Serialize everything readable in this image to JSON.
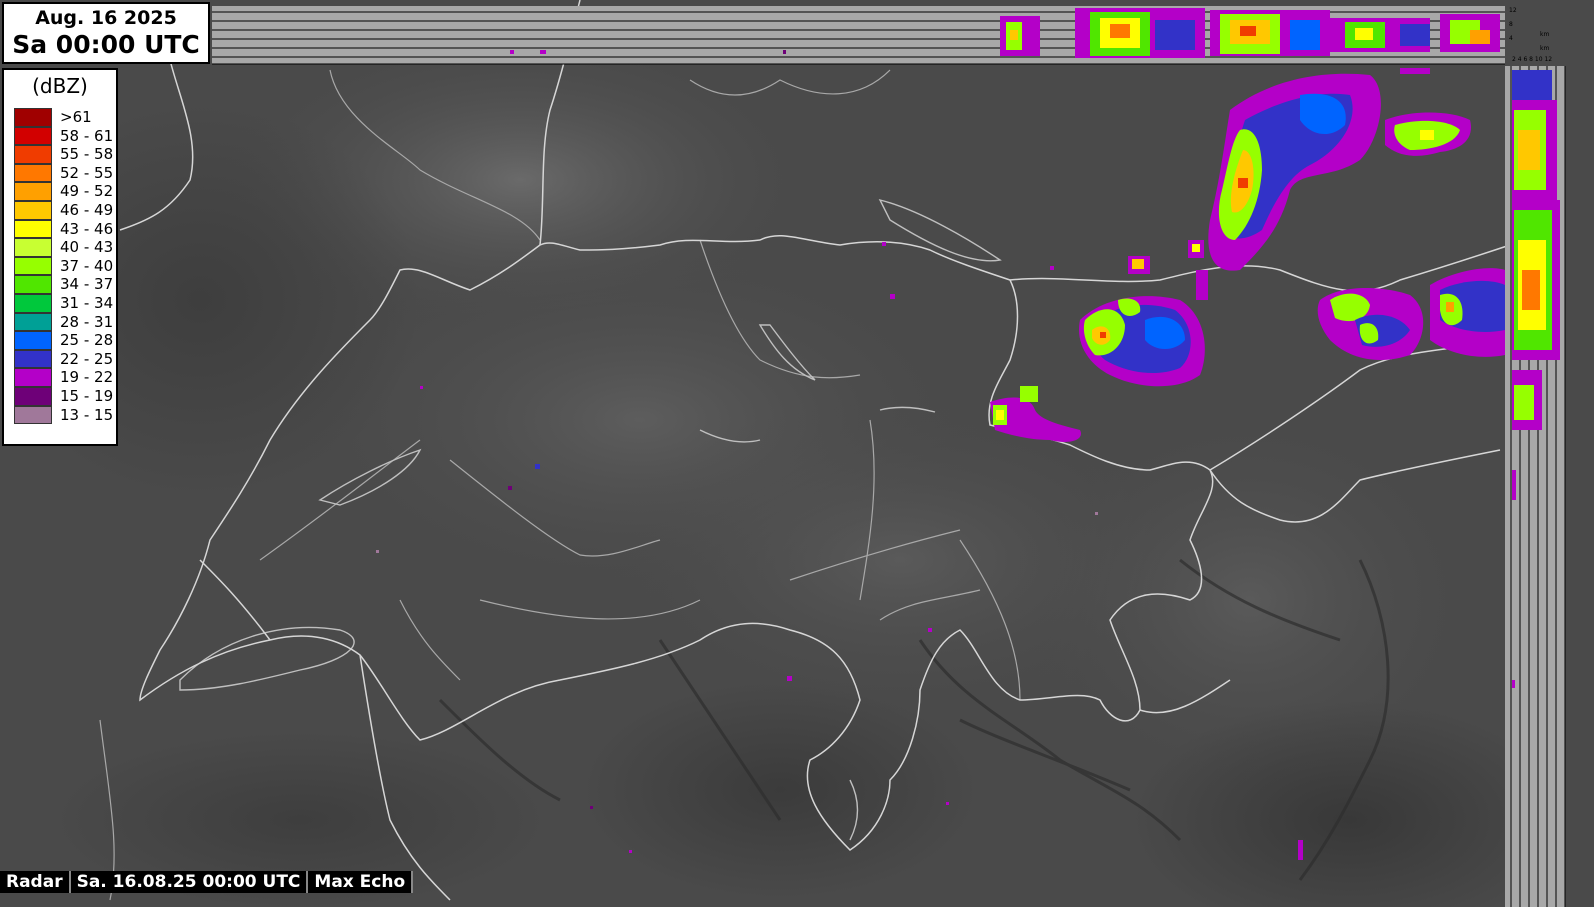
{
  "time_box": {
    "date": "Aug. 16 2025",
    "time": "Sa 00:00 UTC"
  },
  "legend": {
    "unit": "(dBZ)",
    "items": [
      {
        "label": ">61",
        "color": "#a00000"
      },
      {
        "label": "58 - 61",
        "color": "#d20000"
      },
      {
        "label": "55 - 58",
        "color": "#f03c00"
      },
      {
        "label": "52 - 55",
        "color": "#ff7800"
      },
      {
        "label": "49 - 52",
        "color": "#ffa000"
      },
      {
        "label": "46 - 49",
        "color": "#ffc800"
      },
      {
        "label": "43 - 46",
        "color": "#ffff00"
      },
      {
        "label": "40 - 43",
        "color": "#c8ff32"
      },
      {
        "label": "37 - 40",
        "color": "#96ff00"
      },
      {
        "label": "34 - 37",
        "color": "#50e600"
      },
      {
        "label": "31 - 34",
        "color": "#00c83c"
      },
      {
        "label": "28 - 31",
        "color": "#00a096"
      },
      {
        "label": "25 - 28",
        "color": "#0064ff"
      },
      {
        "label": "22 - 25",
        "color": "#3232c8"
      },
      {
        "label": "19 - 22",
        "color": "#b400c8"
      },
      {
        "label": "15 - 19",
        "color": "#6e0078"
      },
      {
        "label": "13 - 15",
        "color": "#a0789a"
      }
    ]
  },
  "status_bar": {
    "product": "Radar",
    "timestamp": "Sa. 16.08.25 00:00 UTC",
    "mode": "Max Echo"
  },
  "colors": {
    "terrain_base": "#4a4a4a",
    "border_line": "#d8d8d8",
    "river_line": "#b0b0b0",
    "side_panel": "#a8a8a8"
  }
}
